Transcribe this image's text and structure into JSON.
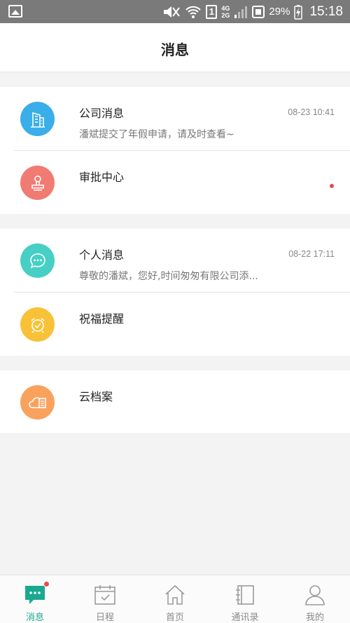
{
  "status_bar": {
    "sim_slot": "1",
    "network_top": "4G",
    "network_bottom": "2G",
    "battery_percent": "29%",
    "time": "15:18"
  },
  "header": {
    "title": "消息"
  },
  "groups": [
    {
      "items": [
        {
          "title": "公司消息",
          "subtitle": "潘斌提交了年假申请，请及时查看~",
          "time": "08-23 10:41",
          "icon": "building-icon",
          "color": "#3aaee8"
        },
        {
          "title": "审批中心",
          "subtitle": "",
          "time": "",
          "icon": "stamp-icon",
          "color": "#f07b73",
          "unread": true
        }
      ]
    },
    {
      "items": [
        {
          "title": "个人消息",
          "subtitle": "尊敬的潘斌，您好,时间匆匆有限公司添...",
          "time": "08-22 17:11",
          "icon": "chat-bubble-icon",
          "color": "#47cfc5"
        },
        {
          "title": "祝福提醒",
          "subtitle": "",
          "time": "",
          "icon": "alarm-clock-icon",
          "color": "#f8c238"
        }
      ]
    },
    {
      "items": [
        {
          "title": "云档案",
          "subtitle": "",
          "time": "",
          "icon": "cloud-file-icon",
          "color": "#f9a25e"
        }
      ]
    }
  ],
  "bottom_nav": {
    "items": [
      {
        "label": "消息",
        "icon": "message-icon",
        "active": true,
        "badge": true
      },
      {
        "label": "日程",
        "icon": "calendar-icon",
        "active": false
      },
      {
        "label": "首页",
        "icon": "home-icon",
        "active": false
      },
      {
        "label": "通讯录",
        "icon": "contacts-book-icon",
        "active": false
      },
      {
        "label": "我的",
        "icon": "person-icon",
        "active": false
      }
    ]
  },
  "colors": {
    "accent": "#19a98f",
    "badge_red": "#e94b4b"
  }
}
